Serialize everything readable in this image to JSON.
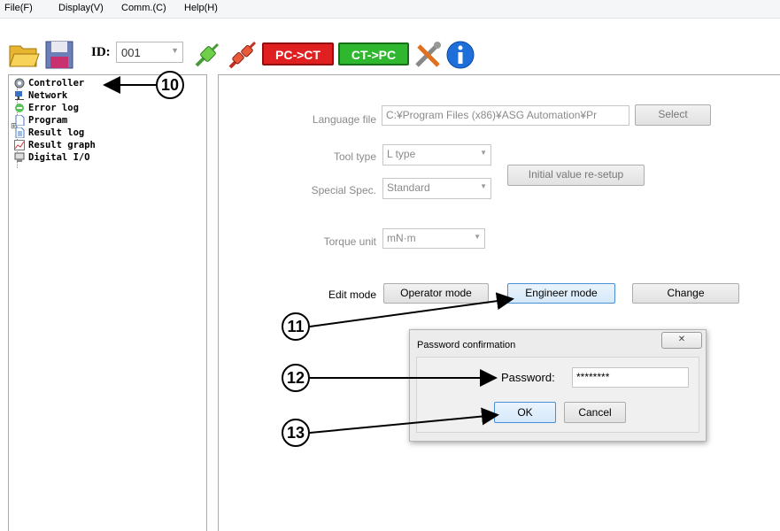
{
  "menu": [
    "File(F)",
    "Display(V)",
    "Comm.(C)",
    "Help(H)"
  ],
  "toolbar": {
    "id_label": "ID:",
    "id_value": "001",
    "pc_to_ct": "PC->CT",
    "ct_to_pc": "CT->PC"
  },
  "tree": {
    "items": [
      {
        "label": "Controller",
        "icon": "gear-icon"
      },
      {
        "label": "Network",
        "icon": "network-icon"
      },
      {
        "label": "Error log",
        "icon": "error-log-icon"
      },
      {
        "label": "Program",
        "icon": "document-icon"
      },
      {
        "label": "Result log",
        "icon": "document-icon"
      },
      {
        "label": "Result graph",
        "icon": "graph-icon"
      },
      {
        "label": "Digital I/O",
        "icon": "io-icon"
      }
    ],
    "expander": "⊞"
  },
  "settings": {
    "language_file_label": "Language file",
    "language_file_value": "C:¥Program Files (x86)¥ASG Automation¥Pr",
    "select_button": "Select",
    "tool_type_label": "Tool type",
    "tool_type_value": "L type",
    "initial_value_button": "Initial value re-setup",
    "special_spec_label": "Special Spec.",
    "special_spec_value": "Standard",
    "torque_unit_label": "Torque unit",
    "torque_unit_value": "mN·m",
    "edit_mode_label": "Edit mode",
    "operator_mode_button": "Operator mode",
    "engineer_mode_button": "Engineer mode",
    "change_button": "Change"
  },
  "dialog": {
    "title": "Password confirmation",
    "close": "✕",
    "password_label": "Password:",
    "password_value": "********",
    "ok_button": "OK",
    "cancel_button": "Cancel"
  },
  "callouts": [
    "10",
    "11",
    "12",
    "13"
  ]
}
